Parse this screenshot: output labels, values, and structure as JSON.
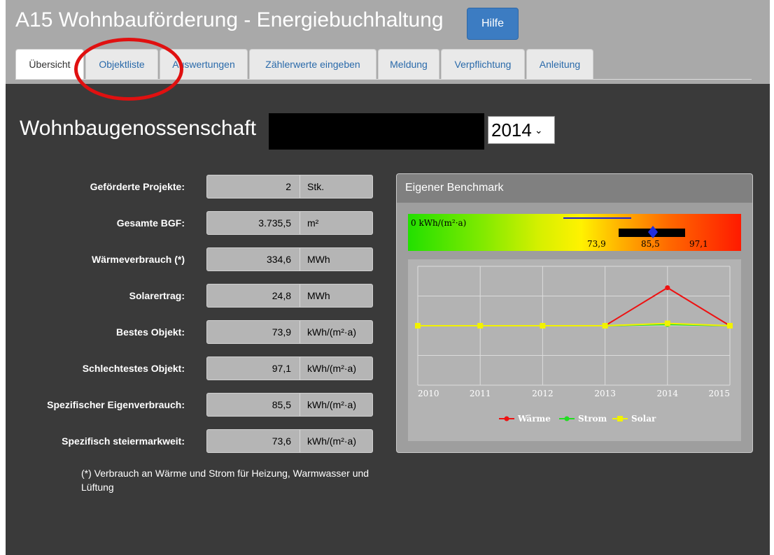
{
  "header": {
    "title": "A15 Wohnbauförderung - Energiebuchhaltung",
    "help_label": "Hilfe"
  },
  "tabs": [
    {
      "label": "Übersicht",
      "active": true
    },
    {
      "label": "Objektliste"
    },
    {
      "label": "Auswertungen"
    },
    {
      "label": "Zählerwerte eingeben"
    },
    {
      "label": "Meldung"
    },
    {
      "label": "Verpflichtung"
    },
    {
      "label": "Anleitung"
    }
  ],
  "org": {
    "name": "Wohnbaugenossenschaft",
    "year": "2014"
  },
  "stats": [
    {
      "label": "Geförderte Projekte:",
      "value": "2",
      "unit": "Stk."
    },
    {
      "label": "Gesamte BGF:",
      "value": "3.735,5",
      "unit": "m²"
    },
    {
      "label": "Wärmeverbrauch (*)",
      "value": "334,6",
      "unit": "MWh"
    },
    {
      "label": "Solarertrag:",
      "value": "24,8",
      "unit": "MWh"
    },
    {
      "label": "Bestes Objekt:",
      "value": "73,9",
      "unit": "kWh/(m²·a)"
    },
    {
      "label": "Schlechtestes Objekt:",
      "value": "97,1",
      "unit": "kWh/(m²·a)"
    },
    {
      "label": "Spezifischer Eigenverbrauch:",
      "value": "85,5",
      "unit": "kWh/(m²·a)"
    },
    {
      "label": "Spezifisch steiermarkweit:",
      "value": "73,6",
      "unit": "kWh/(m²·a)"
    }
  ],
  "footnote": "(*) Verbrauch an Wärme und Strom für Heizung, Warmwasser und Lüftung",
  "benchmark": {
    "title": "Eigener Benchmark",
    "zero_label": "0 kWh/(m²·a)",
    "best": "73,9",
    "own": "85,5",
    "worst": "97,1",
    "colors": {
      "start": "#22e000",
      "mid": "#fff200",
      "end": "#ff1a00",
      "marker": "#1f2ee0"
    }
  },
  "chart_data": {
    "type": "line",
    "x": [
      "2010",
      "2011",
      "2012",
      "2013",
      "2014",
      "2015"
    ],
    "ylim": [
      0,
      100
    ],
    "grid": true,
    "legend_position": "bottom",
    "series": [
      {
        "name": "Wärme",
        "color": "#ee1111",
        "values": [
          null,
          null,
          null,
          50,
          82,
          50
        ]
      },
      {
        "name": "Strom",
        "color": "#22dd22",
        "values": [
          null,
          null,
          null,
          50,
          51,
          50
        ]
      },
      {
        "name": "Solar",
        "color": "#f2f200",
        "values": [
          50,
          50,
          50,
          50,
          52,
          50
        ]
      }
    ]
  }
}
